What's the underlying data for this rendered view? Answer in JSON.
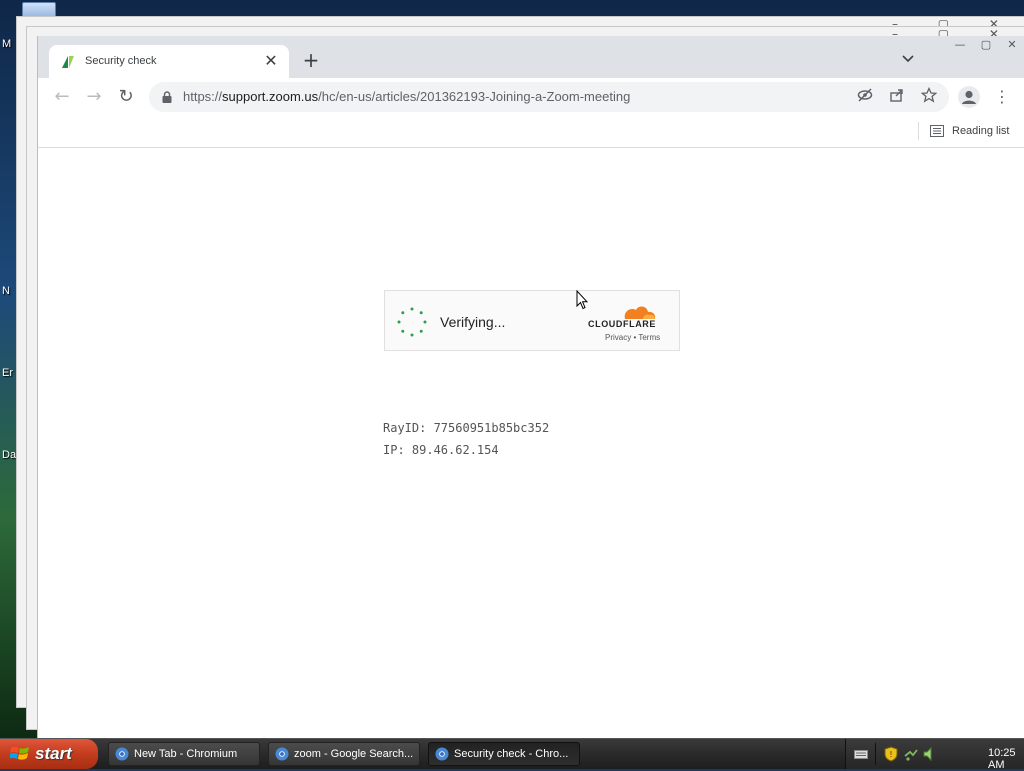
{
  "desktop": {
    "labels": [
      "M",
      "N",
      "Er",
      "Da"
    ]
  },
  "browser": {
    "tab": {
      "title": "Security check",
      "close_glyph": "✕"
    },
    "new_tab_glyph": "+",
    "tab_search_glyph": "⌄",
    "window_controls": {
      "minimize": "—",
      "maximize": "▢",
      "close": "✕"
    },
    "toolbar": {
      "back_glyph": "←",
      "forward_glyph": "→",
      "reload_glyph": "↻",
      "url_scheme": "https://",
      "url_host": "support.zoom.us",
      "url_path": "/hc/en-us/articles/201362193-Joining-a-Zoom-meeting",
      "menu_glyph": "⋮"
    },
    "bookmarks": {
      "reading_list_label": "Reading list"
    }
  },
  "page": {
    "widget": {
      "status": "Verifying...",
      "brand": "CLOUDFLARE",
      "links": "Privacy  •  Terms",
      "brand_color": "#f38020"
    },
    "ray_id": "RayID: 77560951b85bc352",
    "ip": "IP: 89.46.62.154"
  },
  "taskbar": {
    "start_label": "start",
    "tasks": [
      {
        "label": "New Tab - Chromium",
        "active": false
      },
      {
        "label": "zoom - Google Search...",
        "active": false
      },
      {
        "label": "Security check - Chro...",
        "active": true
      }
    ],
    "clock": "10:25 AM"
  }
}
